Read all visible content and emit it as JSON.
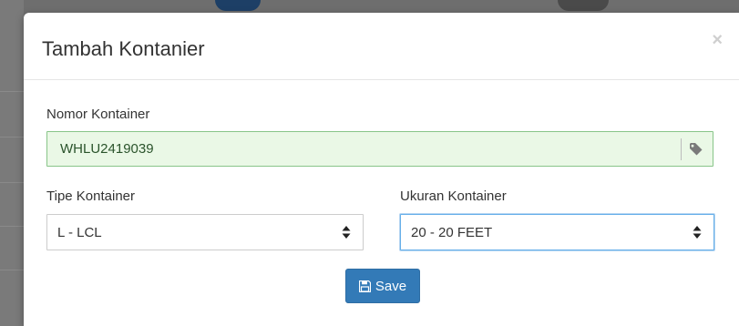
{
  "modal": {
    "title": "Tambah Kontanier",
    "close_label": "×"
  },
  "form": {
    "nomor": {
      "label": "Nomor Kontainer",
      "value": "WHLU2419039",
      "addon_icon": "tag-icon"
    },
    "tipe": {
      "label": "Tipe Kontainer",
      "selected": "L - LCL",
      "icon": "sort-icon"
    },
    "ukuran": {
      "label": "Ukuran Kontainer",
      "selected": "20 - 20 FEET",
      "icon": "sort-icon"
    },
    "save": {
      "label": "Save",
      "icon": "floppy-disk-icon"
    }
  },
  "colors": {
    "primary": "#337ab7",
    "success_bg": "#eaf8e6",
    "success_border": "#88c589",
    "focus_border": "#66afe9"
  }
}
